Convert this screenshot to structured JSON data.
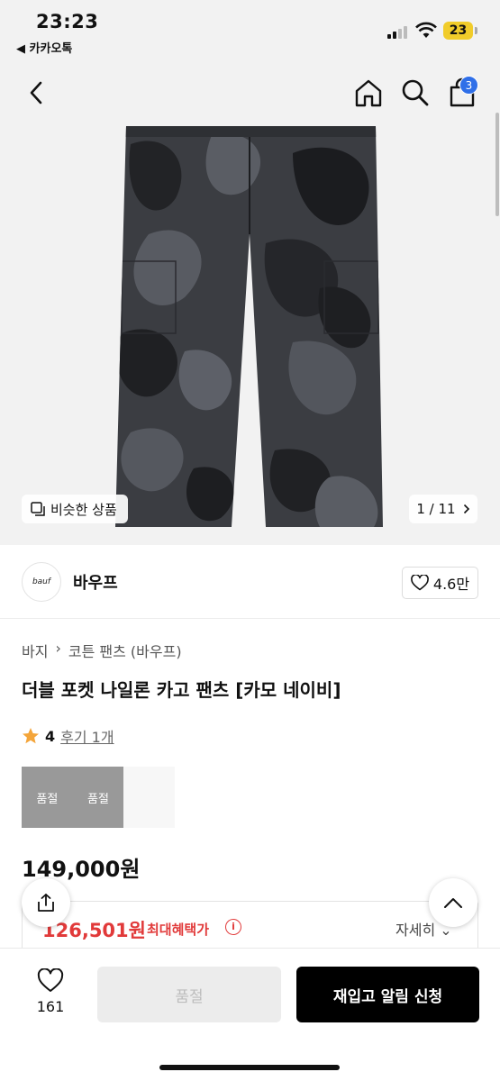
{
  "status": {
    "time": "23:23",
    "back_app": "◀ 카카오톡",
    "battery": "23"
  },
  "header": {
    "cart_count": "3"
  },
  "gallery": {
    "similar_label": "비슷한 상품",
    "page_indicator": "1 / 11"
  },
  "brand": {
    "logo_text": "bauf",
    "name": "바우프",
    "likes": "4.6만"
  },
  "product": {
    "breadcrumb": [
      "바지",
      "코튼 팬츠 (바우프)"
    ],
    "title": "더블 포켓 나일론 카고 팬츠 [카모 네이비]",
    "rating": "4",
    "reviews": "후기 1개",
    "options": [
      {
        "label": "품절"
      },
      {
        "label": "품절"
      },
      {
        "label": ""
      }
    ],
    "price": "149,000원",
    "benefit_price": "126,501원",
    "benefit_label": "최대혜택가",
    "benefit_info": "i",
    "benefit_detail": "자세히 ⌄"
  },
  "bottom": {
    "wish_count": "161",
    "soldout_label": "품절",
    "restock_label": "재입고 알림 신청"
  },
  "colors": {
    "accent_red": "#e13a3a",
    "badge_blue": "#2f6fe8",
    "battery_yellow": "#f1cc2a"
  }
}
